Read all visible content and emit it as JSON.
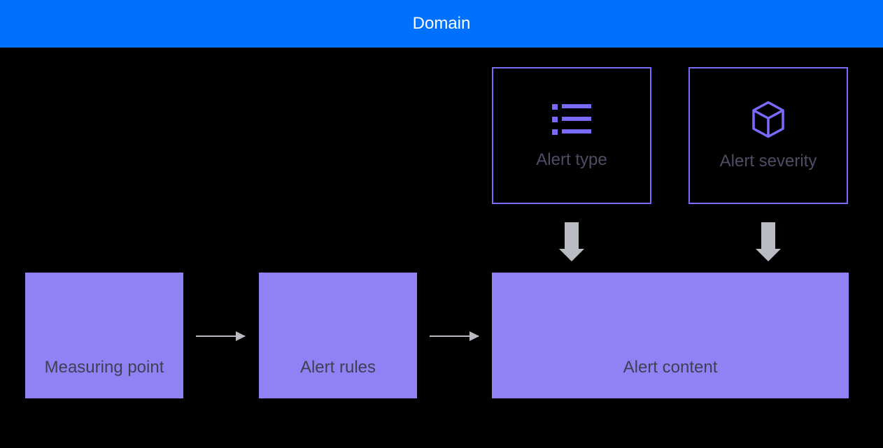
{
  "header": {
    "title": "Domain"
  },
  "boxes": {
    "alert_type": {
      "label": "Alert type"
    },
    "alert_severity": {
      "label": "Alert severity"
    },
    "measuring_point": {
      "label": "Measuring point"
    },
    "alert_rules": {
      "label": "Alert rules"
    },
    "alert_content": {
      "label": "Alert content"
    }
  },
  "colors": {
    "header_bg": "#0070ff",
    "outline": "#7a6bff",
    "fill": "#8e82f5",
    "arrow": "#b8bbc2"
  }
}
